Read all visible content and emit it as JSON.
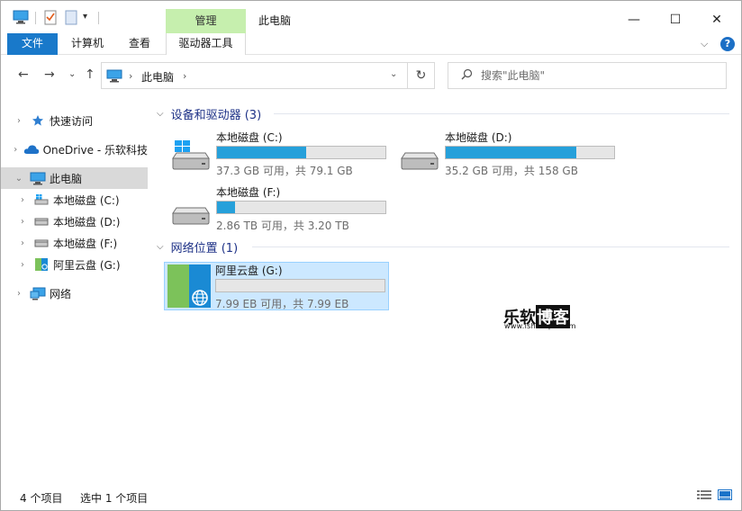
{
  "window": {
    "title": "此电脑",
    "contextual_tab_group": "管理",
    "controls": {
      "minimize": "—",
      "maximize": "☐",
      "close": "✕"
    }
  },
  "ribbon": {
    "tabs": [
      {
        "label": "文件"
      },
      {
        "label": "计算机"
      },
      {
        "label": "查看"
      },
      {
        "label": "驱动器工具"
      }
    ],
    "expand_glyph": "⌵",
    "help_glyph": "?"
  },
  "address_bar": {
    "location": "此电脑",
    "separator": "›",
    "dropdown_glyph": "⌄",
    "refresh_glyph": "↻"
  },
  "search": {
    "placeholder": "搜索\"此电脑\""
  },
  "nav_glyphs": {
    "back": "←",
    "forward": "→",
    "recent": "⌄",
    "up": "↑"
  },
  "sidebar": {
    "items": [
      {
        "label": "快速访问",
        "icon": "star-icon",
        "expander": "›"
      },
      {
        "label": "OneDrive - 乐软科技",
        "icon": "onedrive-cloud-icon",
        "expander": "›"
      },
      {
        "label": "此电脑",
        "icon": "computer-icon",
        "expander": "⌄",
        "selected": true
      },
      {
        "label": "本地磁盘 (C:)",
        "icon": "windows-drive-icon",
        "expander": "›"
      },
      {
        "label": "本地磁盘 (D:)",
        "icon": "drive-icon",
        "expander": "›"
      },
      {
        "label": "本地磁盘 (F:)",
        "icon": "drive-icon",
        "expander": "›"
      },
      {
        "label": "阿里云盘 (G:)",
        "icon": "aliyun-drive-icon",
        "expander": "›"
      },
      {
        "label": "网络",
        "icon": "network-icon",
        "expander": "›"
      }
    ]
  },
  "groups": [
    {
      "header": "设备和驱动器 (3)",
      "drives": [
        {
          "name": "本地磁盘 (C:)",
          "free_text": "37.3 GB 可用，共 79.1 GB",
          "used_fraction": 0.528,
          "icon": "windows-drive-icon"
        },
        {
          "name": "本地磁盘 (D:)",
          "free_text": "35.2 GB 可用，共 158 GB",
          "used_fraction": 0.777,
          "icon": "drive-icon"
        },
        {
          "name": "本地磁盘 (F:)",
          "free_text": "2.86 TB 可用，共 3.20 TB",
          "used_fraction": 0.106,
          "icon": "drive-icon"
        }
      ]
    },
    {
      "header": "网络位置 (1)",
      "drives": [
        {
          "name": "阿里云盘 (G:)",
          "free_text": "7.99 EB 可用，共 7.99 EB",
          "used_fraction": 0.0,
          "icon": "aliyun-network-drive-icon",
          "selected": true
        }
      ]
    }
  ],
  "watermark": {
    "title": "乐软",
    "title_box": "博客",
    "subtitle": "www.isharepc.com"
  },
  "status": {
    "item_count": "4 个项目",
    "selection": "选中 1 个项目"
  },
  "colors": {
    "accent": "#1979ca",
    "manage_tab": "#c6efae",
    "bar_fill": "#26a0da",
    "selection": "#cce8ff",
    "group_header": "#1e3287"
  }
}
